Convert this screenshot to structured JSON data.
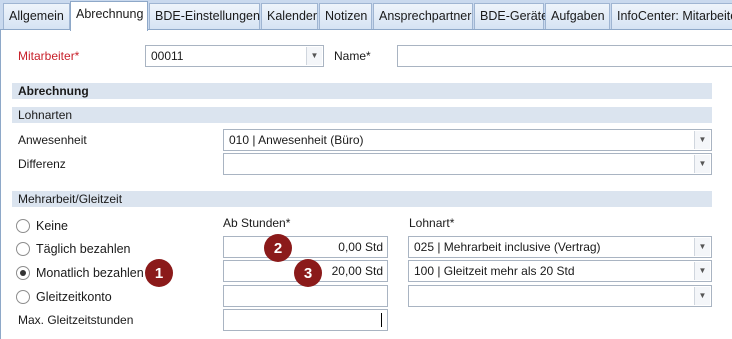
{
  "tabs": [
    {
      "label": "Allgemein"
    },
    {
      "label": "Abrechnung"
    },
    {
      "label": "BDE-Einstellungen"
    },
    {
      "label": "Kalender"
    },
    {
      "label": "Notizen"
    },
    {
      "label": "Ansprechpartner"
    },
    {
      "label": "BDE-Geräte"
    },
    {
      "label": "Aufgaben"
    },
    {
      "label": "InfoCenter: Mitarbeite"
    }
  ],
  "active_tab": "Abrechnung",
  "header": {
    "mitarbeiter_label": "Mitarbeiter*",
    "mitarbeiter_value": "00011",
    "name_label": "Name*",
    "name_value": ""
  },
  "abrechnung": {
    "title": "Abrechnung",
    "lohnarten": {
      "title": "Lohnarten",
      "anwesenheit_label": "Anwesenheit",
      "anwesenheit_value": "010 | Anwesenheit (Büro)",
      "differenz_label": "Differenz",
      "differenz_value": ""
    }
  },
  "mehrarbeit": {
    "title": "Mehrarbeit/Gleitzeit",
    "col_hours": "Ab Stunden*",
    "col_lohnart": "Lohnart*",
    "options": [
      {
        "label": "Keine",
        "checked": false
      },
      {
        "label": "Täglich bezahlen",
        "checked": false,
        "hours": "0,00 Std",
        "lohnart": "025 | Mehrarbeit inclusive (Vertrag)"
      },
      {
        "label": "Monatlich bezahlen",
        "checked": true,
        "hours": "20,00 Std",
        "lohnart": "100 | Gleitzeit mehr als 20 Std"
      },
      {
        "label": "Gleitzeitkonto",
        "checked": false,
        "hours": "",
        "lohnart": ""
      }
    ],
    "max_label": "Max. Gleitzeitstunden",
    "max_value": ""
  },
  "callouts": [
    "1",
    "2",
    "3"
  ],
  "colors": {
    "required": "#c8202a",
    "badge": "#8b1a1a",
    "section_bg": "#dbe4ef",
    "tab_bg": "#c9d9ee"
  }
}
